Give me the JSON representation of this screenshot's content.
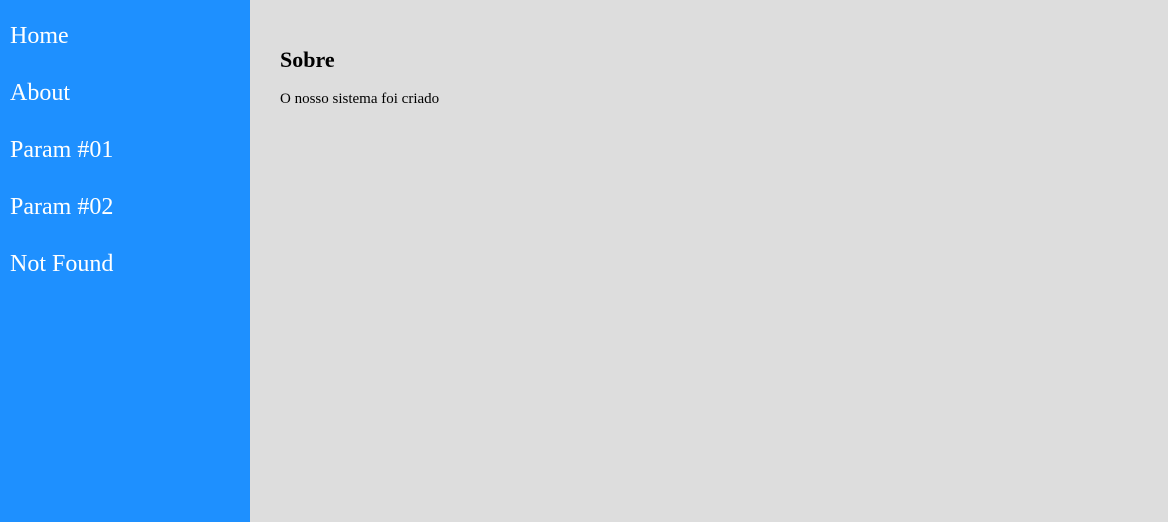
{
  "sidebar": {
    "items": [
      {
        "label": "Home"
      },
      {
        "label": "About"
      },
      {
        "label": "Param #01"
      },
      {
        "label": "Param #02"
      },
      {
        "label": "Not Found"
      }
    ]
  },
  "main": {
    "title": "Sobre",
    "text": "O nosso sistema foi criado"
  },
  "colors": {
    "sidebar_bg": "#1e90ff",
    "main_bg": "#dddddd",
    "nav_text": "#ffffff",
    "content_text": "#000000"
  }
}
